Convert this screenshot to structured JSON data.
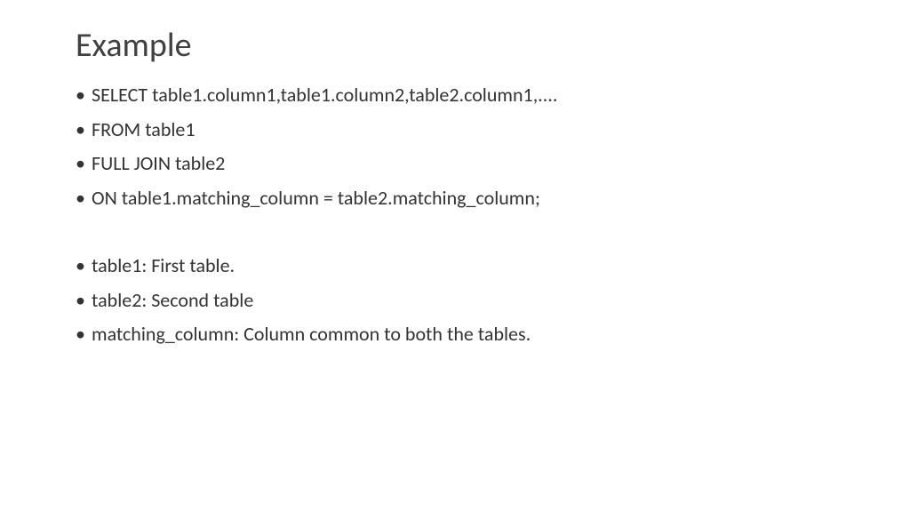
{
  "title": "Example",
  "bullets_top": [
    "SELECT table1.column1,table1.column2,table2.column1,....",
    "FROM table1",
    "FULL JOIN table2",
    "ON table1.matching_column = table2.matching_column;"
  ],
  "bullets_bottom": [
    "table1: First table.",
    "table2: Second table",
    "matching_column: Column common to both the tables."
  ]
}
